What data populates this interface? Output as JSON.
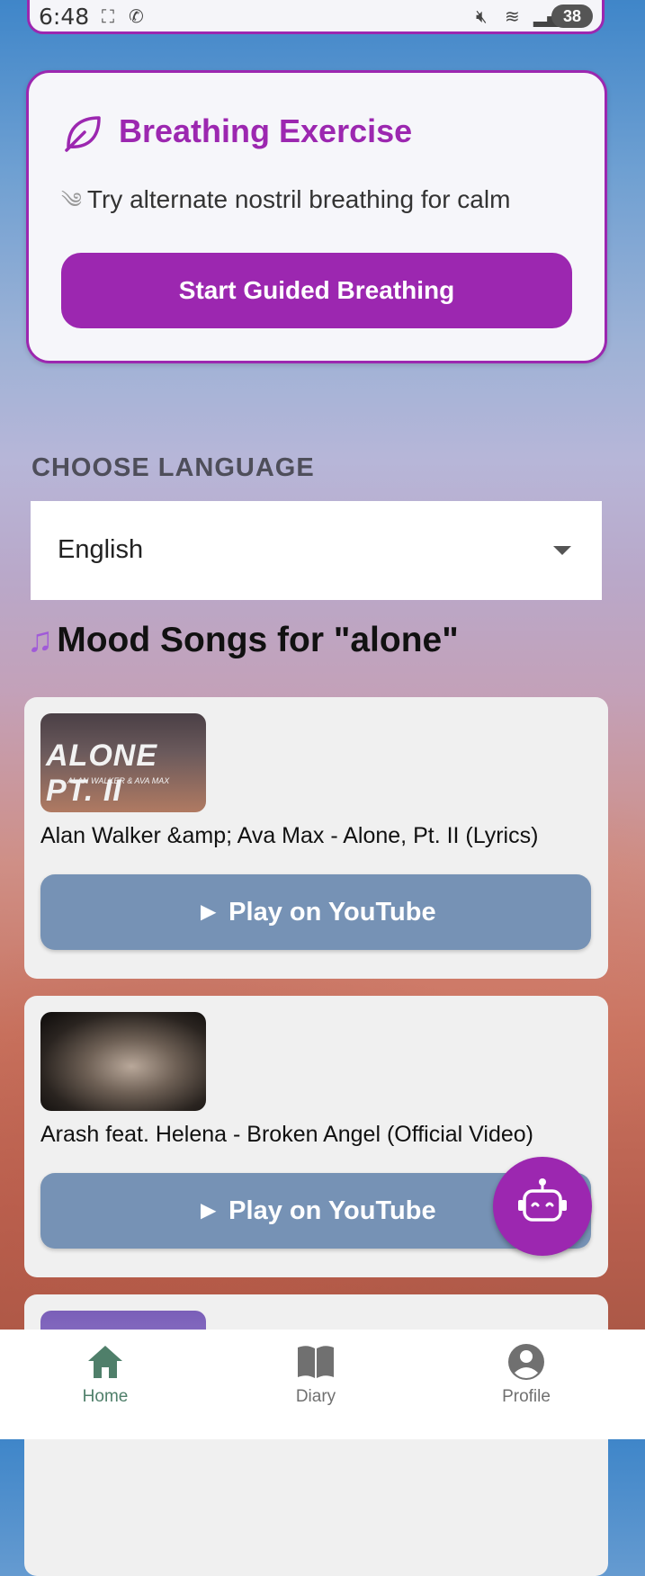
{
  "status_bar": {
    "time": "6:48",
    "battery": "38"
  },
  "breathing": {
    "title": "Breathing Exercise",
    "subtitle": "Try alternate nostril breathing for calm",
    "button_label": "Start Guided Breathing"
  },
  "language": {
    "label": "CHOOSE LANGUAGE",
    "selected": "English"
  },
  "mood": {
    "title": "Mood Songs for \"alone\"",
    "songs": [
      {
        "thumbnail_text": "ALONE PT. II",
        "thumbnail_subtext": "ALAN WALKER & AVA MAX",
        "title": "Alan Walker &amp; Ava Max - Alone, Pt. II (Lyrics)",
        "button_label": "► Play on YouTube"
      },
      {
        "title": "Arash feat. Helena - Broken Angel (Official Video)",
        "button_label": "► Play on YouTube"
      }
    ]
  },
  "bottom_nav": {
    "items": [
      {
        "label": "Home",
        "icon": "home-icon",
        "active": true
      },
      {
        "label": "Diary",
        "icon": "book-icon",
        "active": false
      },
      {
        "label": "Profile",
        "icon": "account-icon",
        "active": false
      }
    ]
  },
  "colors": {
    "accent": "#9c27b0",
    "youtube_button": "#7692b5",
    "nav_active": "#4f7f6a",
    "nav_inactive": "#707070"
  }
}
